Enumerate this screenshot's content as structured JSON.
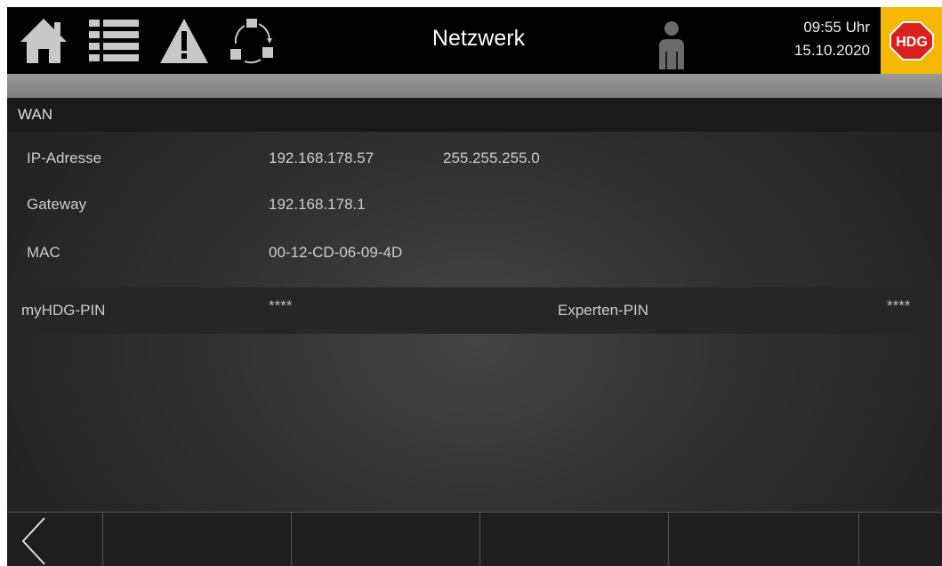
{
  "header": {
    "title": "Netzwerk",
    "time": "09:55 Uhr",
    "date": "15.10.2020",
    "logo_text": "HDG",
    "icons": [
      "home-icon",
      "menu-list-icon",
      "warning-icon",
      "sync-icon",
      "user-icon"
    ]
  },
  "wan": {
    "heading": "WAN",
    "ip_label": "IP-Adresse",
    "ip_value": "192.168.178.57",
    "subnet_value": "255.255.255.0",
    "gateway_label": "Gateway",
    "gateway_value": "192.168.178.1",
    "mac_label": "MAC",
    "mac_value": "00-12-CD-06-09-4D"
  },
  "pins": {
    "myhdg_label": "myHDG-PIN",
    "myhdg_value": "****",
    "expert_label": "Experten-PIN",
    "expert_value": "****"
  },
  "footer": {
    "back_icon": "back-arrow-icon"
  },
  "colors": {
    "accent": "#f5b800",
    "logo_red": "#d9201e",
    "header_bg": "#000000"
  }
}
